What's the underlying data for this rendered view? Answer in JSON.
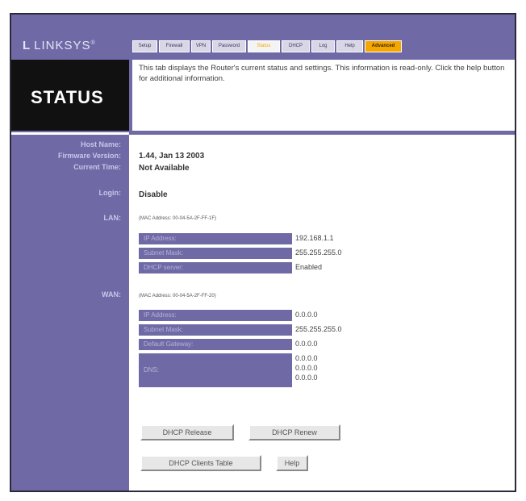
{
  "brand": {
    "mark": "L",
    "name": "LINKSYS",
    "tm": "®"
  },
  "tabs": [
    {
      "label": "Setup"
    },
    {
      "label": "Firewall"
    },
    {
      "label": "VPN"
    },
    {
      "label": "Password"
    },
    {
      "label": "Status"
    },
    {
      "label": "DHCP"
    },
    {
      "label": "Log"
    },
    {
      "label": "Help"
    },
    {
      "label": "Advanced"
    }
  ],
  "page_title": "STATUS",
  "description": "This tab displays the Router's current status and settings. This information is read-only. Click the help button for additional information.",
  "labels": {
    "host_name": "Host Name:",
    "firmware_version": "Firmware Version:",
    "current_time": "Current Time:",
    "login": "Login:",
    "lan": "LAN:",
    "wan": "WAN:"
  },
  "values": {
    "firmware_version": "1.44, Jan 13 2003",
    "current_time": "Not Available",
    "login": "Disable"
  },
  "lan": {
    "mac": "(MAC Address: 00-04-5A-2F-FF-1F)",
    "rows": [
      {
        "key": "IP Address:",
        "value": "192.168.1.1"
      },
      {
        "key": "Subnet Mask:",
        "value": "255.255.255.0"
      },
      {
        "key": "DHCP server:",
        "value": "Enabled"
      }
    ]
  },
  "wan": {
    "mac": "(MAC Address: 00-04-5A-2F-FF-20)",
    "rows": [
      {
        "key": "IP Address:",
        "value": "0.0.0.0"
      },
      {
        "key": "Subnet Mask:",
        "value": "255.255.255.0"
      },
      {
        "key": "Default Gateway:",
        "value": "0.0.0.0"
      }
    ],
    "dns_key": "DNS:",
    "dns_values": [
      "0.0.0.0",
      "0.0.0.0",
      "0.0.0.0"
    ]
  },
  "buttons": {
    "dhcp_release": "DHCP Release",
    "dhcp_renew": "DHCP Renew",
    "dhcp_clients_table": "DHCP Clients Table",
    "help": "Help"
  },
  "colors": {
    "accent": "#6f6aa6",
    "advanced_tab": "#f5a700",
    "title_bg": "#111111"
  }
}
